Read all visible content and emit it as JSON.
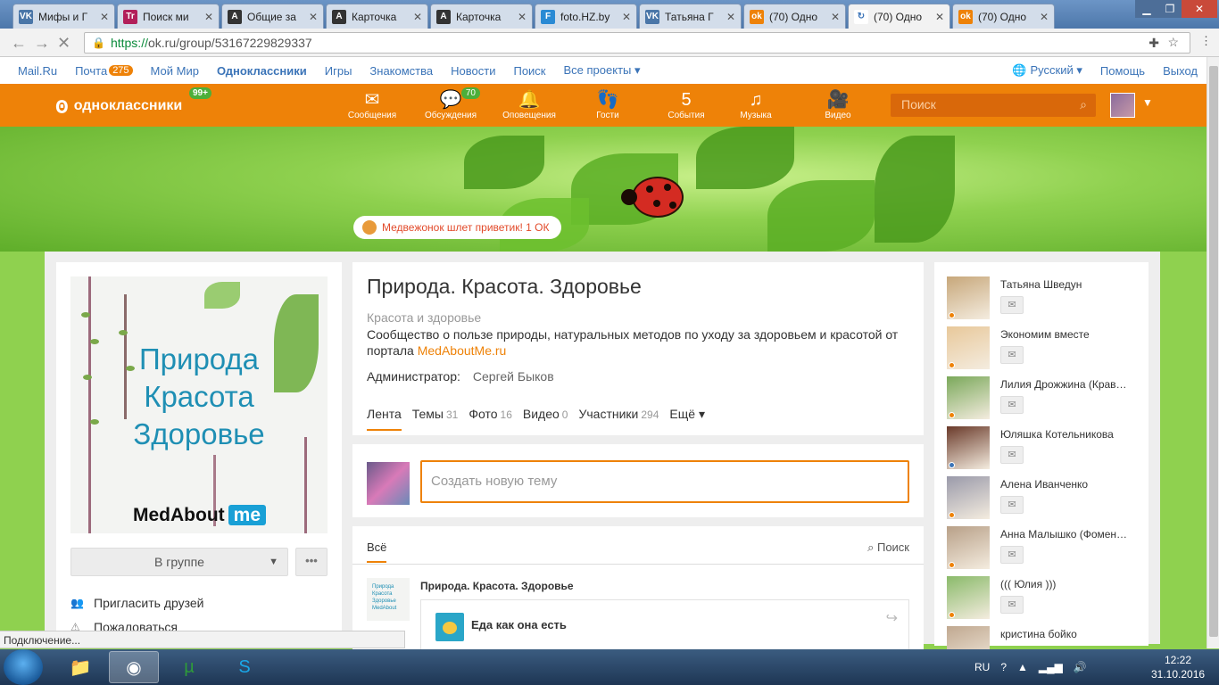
{
  "browser": {
    "tabs": [
      {
        "title": "Мифы и Г",
        "fav_color": "#4a76a8",
        "fav_glyph": "VK"
      },
      {
        "title": "Поиск ми",
        "fav_color": "#b21f5a",
        "fav_glyph": "Tr"
      },
      {
        "title": "Общие за",
        "fav_color": "#333333",
        "fav_glyph": "A"
      },
      {
        "title": "Карточка",
        "fav_color": "#333333",
        "fav_glyph": "A"
      },
      {
        "title": "Карточка",
        "fav_color": "#333333",
        "fav_glyph": "A"
      },
      {
        "title": "foto.HZ.by",
        "fav_color": "#2a8ad4",
        "fav_glyph": "F"
      },
      {
        "title": "Татьяна Г",
        "fav_color": "#4a76a8",
        "fav_glyph": "VK"
      },
      {
        "title": "(70) Одно",
        "fav_color": "#ee8208",
        "fav_glyph": "ok"
      },
      {
        "title": "(70) Одно",
        "fav_color": "#ffffff",
        "fav_glyph": "↻",
        "active": true
      },
      {
        "title": "(70) Одно",
        "fav_color": "#ee8208",
        "fav_glyph": "ok"
      }
    ],
    "url_scheme": "https://",
    "url_rest": "ok.ru/group/53167229829337",
    "status_text": "Подключение..."
  },
  "topbar": {
    "left": [
      {
        "label": "Mail.Ru"
      },
      {
        "label": "Почта",
        "badge": "275"
      },
      {
        "label": "Мой Мир"
      },
      {
        "label": "Одноклассники",
        "bold": true
      },
      {
        "label": "Игры"
      },
      {
        "label": "Знакомства"
      },
      {
        "label": "Новости"
      },
      {
        "label": "Поиск"
      },
      {
        "label": "Все проекты ▾"
      }
    ],
    "language": "Русский ▾",
    "help": "Помощь",
    "logout": "Выход"
  },
  "header": {
    "logo": "одноклассники",
    "logo_badge": "99+",
    "nav": [
      {
        "label": "Сообщения",
        "icon": "envelope-icon",
        "glyph": "✉"
      },
      {
        "label": "Обсуждения",
        "icon": "chat-icon",
        "glyph": "💬",
        "badge": "70"
      },
      {
        "label": "Оповещения",
        "icon": "bell-icon",
        "glyph": "🔔"
      },
      {
        "label": "Гости",
        "icon": "footprints-icon",
        "glyph": "👣"
      },
      {
        "label": "События",
        "icon": "events-icon",
        "glyph": "5"
      },
      {
        "label": "Музыка",
        "icon": "music-icon",
        "glyph": "♫"
      },
      {
        "label": "Видео",
        "icon": "video-icon",
        "glyph": "🎥"
      }
    ],
    "search_placeholder": "Поиск",
    "accent": "#ee8208"
  },
  "banner": {
    "greeting": "Медвежонок шлет приветик! 1 ОК"
  },
  "group": {
    "cover_title_lines": [
      "Природа",
      "Красота",
      "Здоровье"
    ],
    "cover_brand": "MedAbout",
    "cover_brand_me": "me",
    "membership_button": "В группе",
    "more_button": "•••",
    "invite": "Пригласить друзей",
    "report": "Пожаловаться",
    "title": "Природа. Красота. Здоровье",
    "category": "Красота и здоровье",
    "description": "Сообщество о пользе природы, натуральных методов по уходу за здоровьем и красотой от портала ",
    "description_link": "MedAboutMe.ru",
    "admin_label": "Администратор:",
    "admin_name": "Сергей Быков",
    "tabs": [
      {
        "label": "Лента",
        "count": "",
        "active": true
      },
      {
        "label": "Темы",
        "count": "31"
      },
      {
        "label": "Фото",
        "count": "16"
      },
      {
        "label": "Видео",
        "count": "0"
      },
      {
        "label": "Участники",
        "count": "294"
      },
      {
        "label": "Ещё ▾",
        "count": ""
      }
    ],
    "new_topic_placeholder": "Создать новую тему"
  },
  "feed": {
    "filter_tab": "Всё",
    "search": "Поиск",
    "post_author": "Природа. Красота. Здоровье",
    "post_title": "Еда как она есть",
    "post_thumb_text": "Природа Красота Здоровье MedAbout"
  },
  "members": [
    {
      "name": "Татьяна Шведун",
      "online": "#ee8208",
      "photo": "#c7a77a"
    },
    {
      "name": "Экономим вместе",
      "online": "#ee8208",
      "photo": "#e8c89a"
    },
    {
      "name": "Лилия Дрожжина (Крав…",
      "online": "#ee8208",
      "photo": "#7aa85a"
    },
    {
      "name": "Юляшка Котельникова",
      "online": "#3b74b8",
      "photo": "#6a3a2a"
    },
    {
      "name": "Алена Иванченко",
      "online": "#ee8208",
      "photo": "#9a9aaa"
    },
    {
      "name": "Анна Малышко (Фомен…",
      "online": "#ee8208",
      "photo": "#b8a088"
    },
    {
      "name": "((( Юлия )))",
      "online": "#ee8208",
      "photo": "#8aba6a"
    },
    {
      "name": "кристина бойко",
      "online": "",
      "photo": "#c0a890"
    }
  ],
  "taskbar": {
    "apps": [
      {
        "name": "explorer",
        "glyph": "📁"
      },
      {
        "name": "chrome",
        "glyph": "◉",
        "active": true
      },
      {
        "name": "utorrent",
        "glyph": "µ"
      },
      {
        "name": "skype",
        "glyph": "S"
      }
    ],
    "lang": "RU",
    "time": "12:22",
    "date": "31.10.2016"
  }
}
